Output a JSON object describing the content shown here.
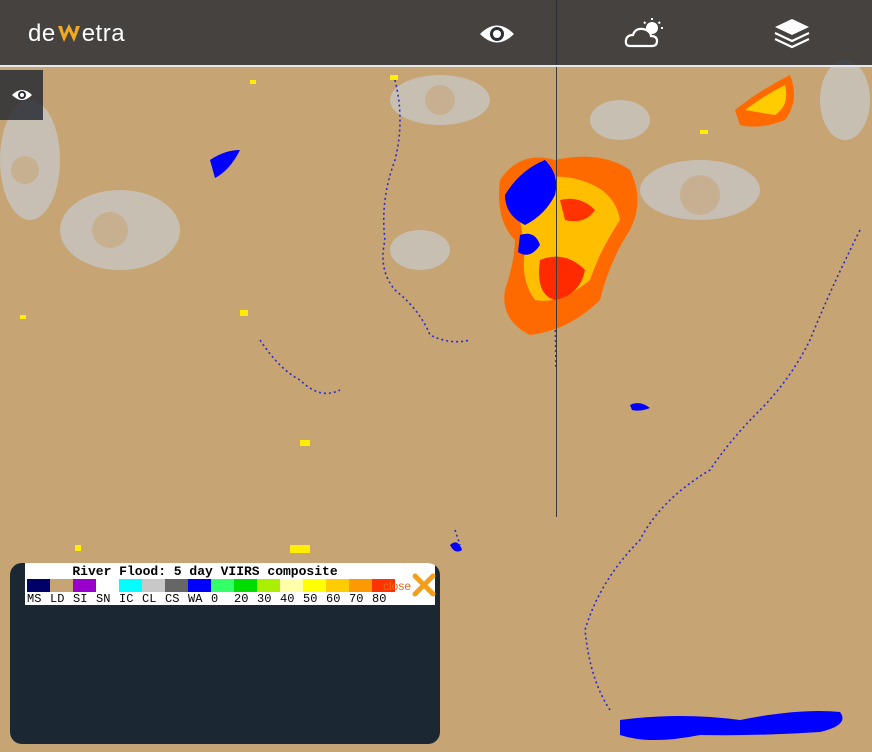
{
  "header": {
    "logo_text": "dewetra",
    "icons": [
      "eye-icon",
      "cloud-sun-icon",
      "layers-icon"
    ]
  },
  "side": {
    "icon": "eye-icon"
  },
  "legend": {
    "title": "River Flood: 5 day VIIRS composite",
    "close_label": "close",
    "close_icon": "close-x-icon",
    "items": [
      {
        "label": "MS",
        "color": "#000066"
      },
      {
        "label": "LD",
        "color": "#c6a474"
      },
      {
        "label": "SI",
        "color": "#9900cc"
      },
      {
        "label": "SN",
        "color": "#ffffff"
      },
      {
        "label": "IC",
        "color": "#00ffff"
      },
      {
        "label": "CL",
        "color": "#c8c8c8"
      },
      {
        "label": "CS",
        "color": "#666666"
      },
      {
        "label": "WA",
        "color": "#0000ff"
      },
      {
        "label": "0",
        "color": "#33ff66"
      },
      {
        "label": "20",
        "color": "#00dd00"
      },
      {
        "label": "30",
        "color": "#aaee00"
      },
      {
        "label": "40",
        "color": "#ffffaa"
      },
      {
        "label": "50",
        "color": "#ffff00"
      },
      {
        "label": "60",
        "color": "#ffcc00"
      },
      {
        "label": "70",
        "color": "#ff9900"
      },
      {
        "label": "80",
        "color": "#ff3300"
      }
    ]
  },
  "colors": {
    "land": "#c6a474",
    "water": "#0000ff",
    "cloud": "#c8c8c8",
    "flood_high": "#ff3300",
    "flood_mid": "#ffcc00"
  }
}
